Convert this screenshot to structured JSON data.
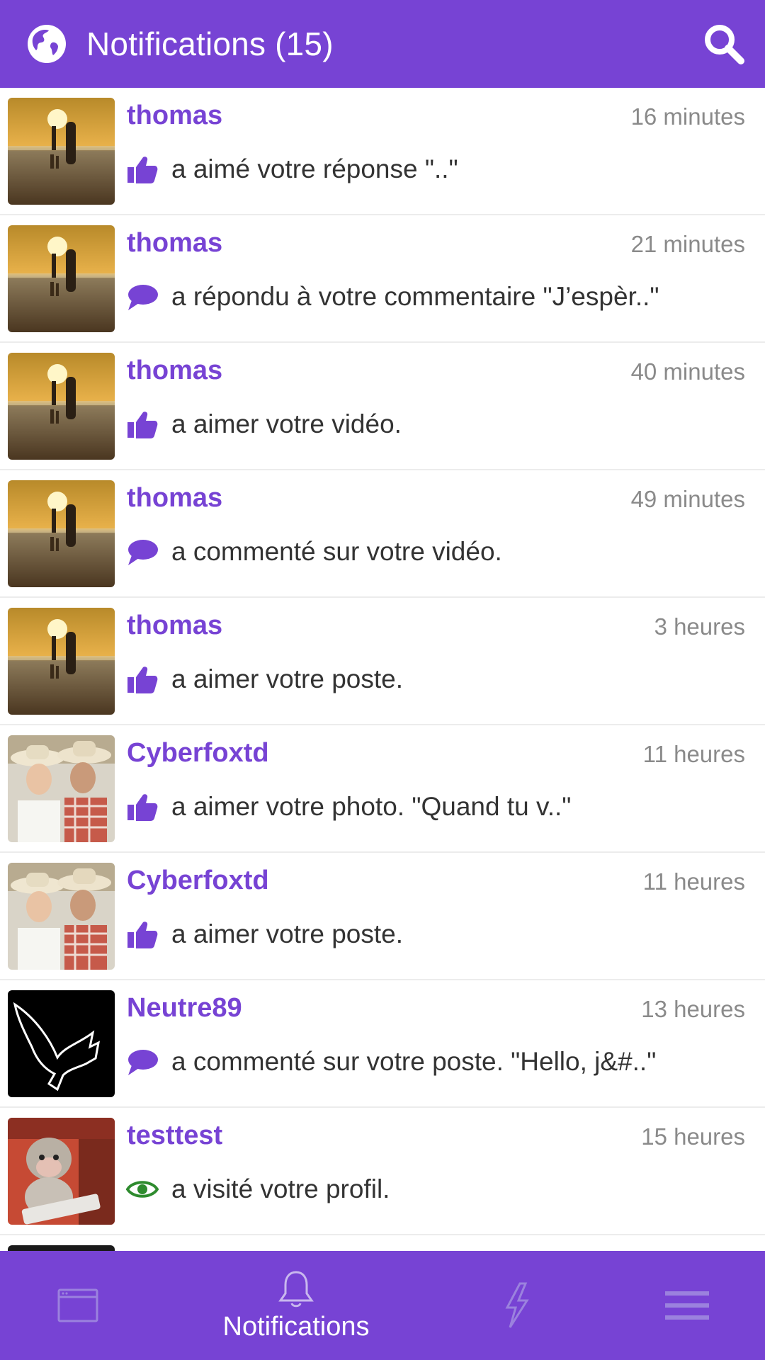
{
  "header": {
    "title": "Notifications (15)",
    "globe_icon": "globe-icon",
    "search_icon": "search-icon",
    "color": "#7743d4"
  },
  "notifications": [
    {
      "user": "thomas",
      "time": "16 minutes",
      "icon": "thumbs-up-icon",
      "text": "a aimé votre réponse \"..\"",
      "avatar": "sunset-beach-photo"
    },
    {
      "user": "thomas",
      "time": "21 minutes",
      "icon": "comment-icon",
      "text": "a répondu à votre commentaire \"J’espèr..\"",
      "avatar": "sunset-beach-photo"
    },
    {
      "user": "thomas",
      "time": "40 minutes",
      "icon": "thumbs-up-icon",
      "text": "a aimer votre vidéo.",
      "avatar": "sunset-beach-photo"
    },
    {
      "user": "thomas",
      "time": "49 minutes",
      "icon": "comment-icon",
      "text": "a commenté sur votre vidéo.",
      "avatar": "sunset-beach-photo"
    },
    {
      "user": "thomas",
      "time": "3 heures",
      "icon": "thumbs-up-icon",
      "text": "a aimer votre poste.",
      "avatar": "sunset-beach-photo"
    },
    {
      "user": "Cyberfoxtd",
      "time": "11 heures",
      "icon": "thumbs-up-icon",
      "text": "a aimer votre photo. \"Quand tu v..\"",
      "avatar": "couple-cowboy-hats-photo"
    },
    {
      "user": "Cyberfoxtd",
      "time": "11 heures",
      "icon": "thumbs-up-icon",
      "text": "a aimer votre poste.",
      "avatar": "couple-cowboy-hats-photo"
    },
    {
      "user": "Neutre89",
      "time": "13 heures",
      "icon": "comment-icon",
      "text": "a commenté sur votre poste. \"Hello, j&#..\"",
      "avatar": "eagle-outline-photo"
    },
    {
      "user": "testtest",
      "time": "15 heures",
      "icon": "eye-icon",
      "text": "a visité votre profil.",
      "avatar": "monkey-desk-photo"
    }
  ],
  "bottom_nav": {
    "items": [
      {
        "name": "feed",
        "icon": "browser-window-icon",
        "label": ""
      },
      {
        "name": "notifications",
        "icon": "bell-icon",
        "label": "Notifications"
      },
      {
        "name": "activity",
        "icon": "lightning-icon",
        "label": ""
      },
      {
        "name": "menu",
        "icon": "hamburger-menu-icon",
        "label": ""
      }
    ]
  },
  "colors": {
    "brand": "#7743d4",
    "eye": "#2e8b2e",
    "time": "#8a8a8a",
    "text": "#333333"
  }
}
